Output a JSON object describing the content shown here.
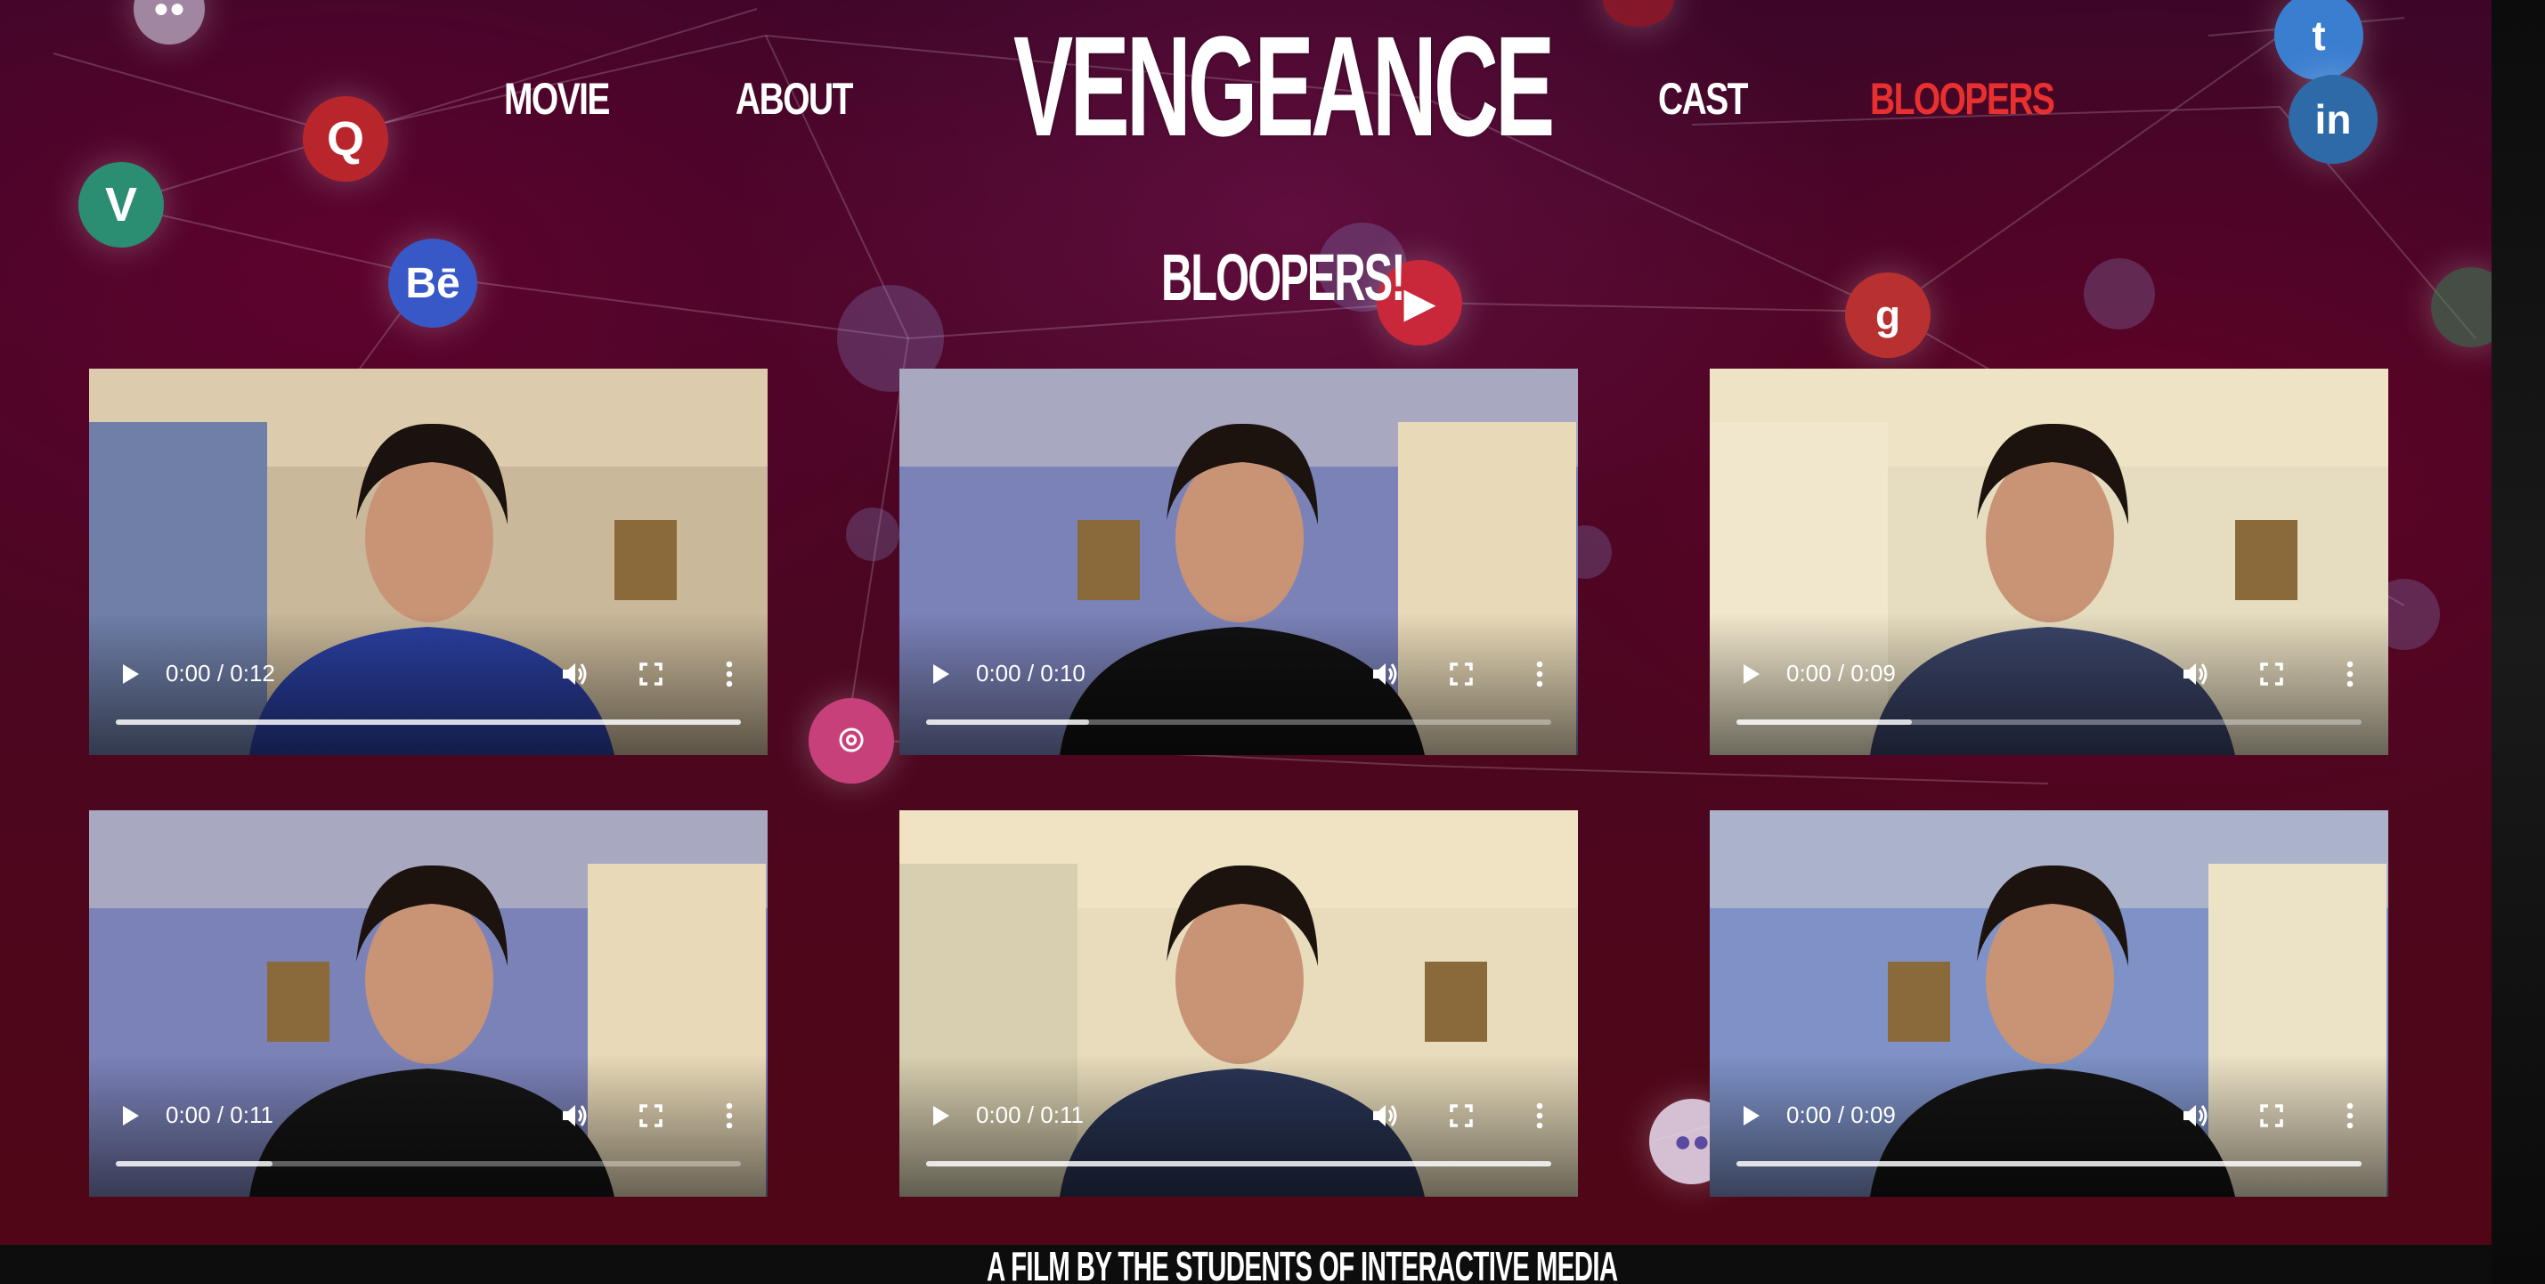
{
  "nav": {
    "brand": "VENGEANCE",
    "links": [
      {
        "label": "MOVIE",
        "active": false
      },
      {
        "label": "ABOUT",
        "active": false
      },
      {
        "label": "CAST",
        "active": false
      },
      {
        "label": "BLOOPERS",
        "active": true
      }
    ]
  },
  "page": {
    "heading": "BLOOPERS!"
  },
  "videos": [
    {
      "time": "0:00 / 0:12",
      "buffered": 1.0
    },
    {
      "time": "0:00 / 0:10",
      "buffered": 0.26
    },
    {
      "time": "0:00 / 0:09",
      "buffered": 0.28
    },
    {
      "time": "0:00 / 0:11",
      "buffered": 0.25
    },
    {
      "time": "0:00 / 0:11",
      "buffered": 1.0
    },
    {
      "time": "0:00 / 0:09",
      "buffered": 1.0
    }
  ],
  "footer": {
    "text": "A FILM BY THE STUDENTS OF INTERACTIVE MEDIA"
  },
  "colors": {
    "accent": "#e8302f",
    "text": "#ffffff",
    "background": "#4a0623"
  }
}
